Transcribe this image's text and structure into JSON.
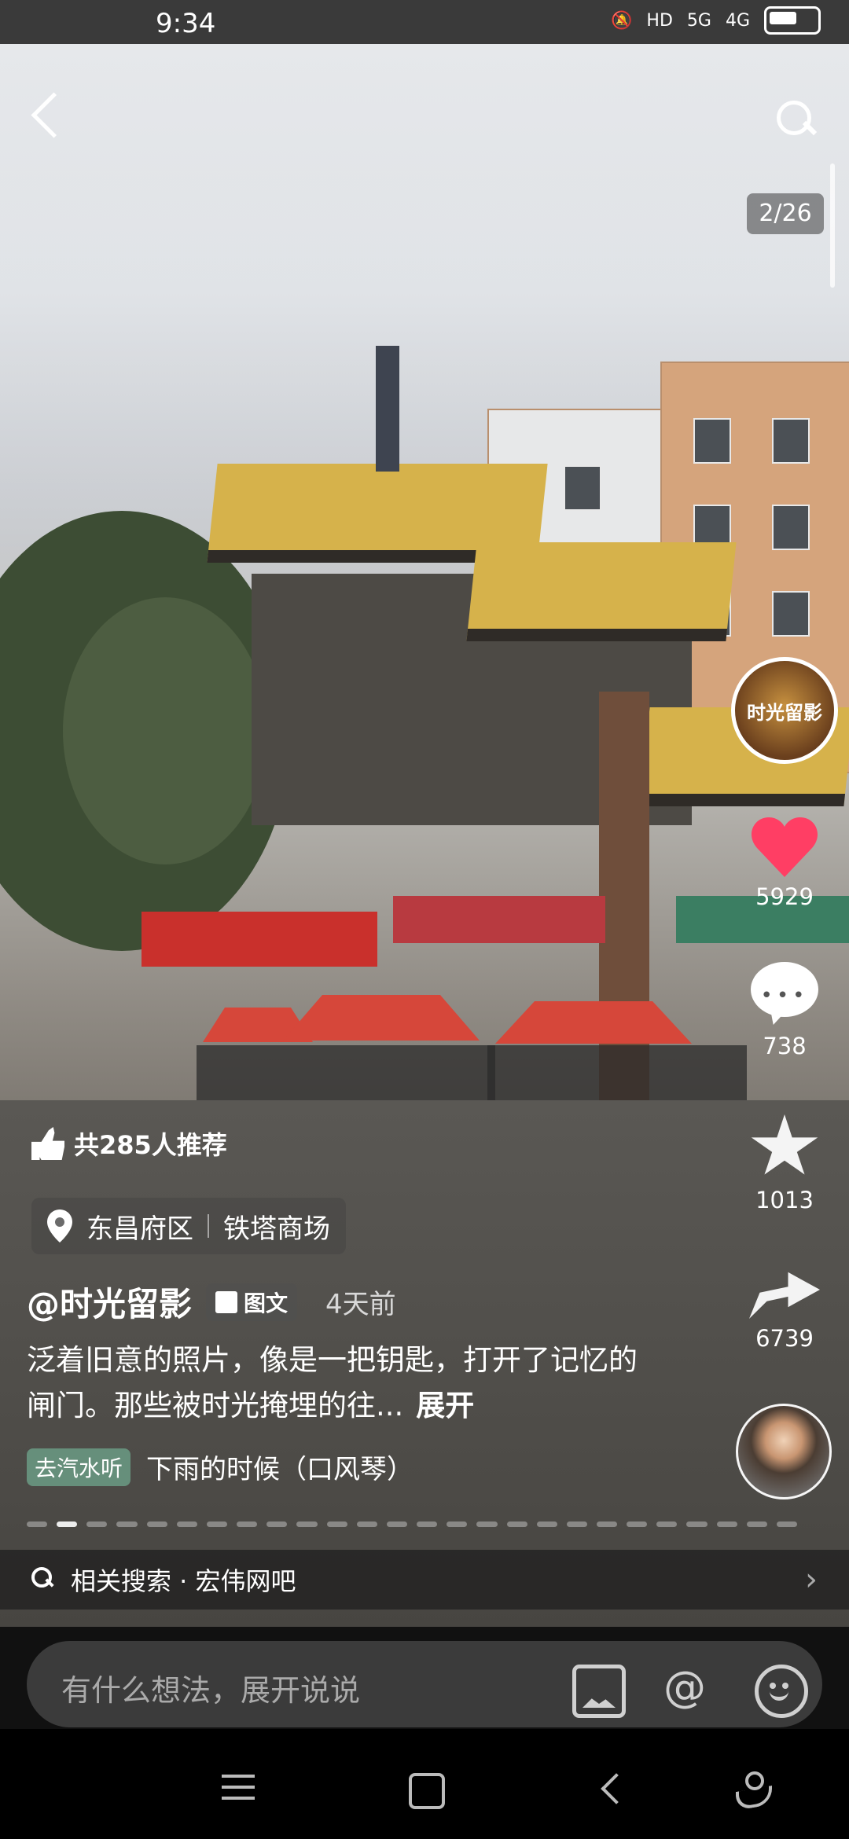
{
  "status_bar": {
    "time": "9:34",
    "network_icons": [
      "mute-icon",
      "HD",
      "5G",
      "4G",
      "battery-icon"
    ]
  },
  "header": {
    "image_counter": "2/26"
  },
  "author_avatar_text": "时光留影",
  "actions": {
    "likes": "5929",
    "comments": "738",
    "favorites": "1013",
    "shares": "6739"
  },
  "post": {
    "recommend_text": "共285人推荐",
    "location": {
      "district": "东昌府区",
      "place": "铁塔商场"
    },
    "author": "@时光留影",
    "type_tag": "图文",
    "time_ago": "4天前",
    "caption": "泛着旧意的照片，像是一把钥匙，打开了记忆的闸门。那些被时光掩埋的往...",
    "expand_label": "展开",
    "music_tag": "去汽水听",
    "music_title": "下雨的时候（口风琴）"
  },
  "related_search": {
    "label": "相关搜索 · 宏伟网吧"
  },
  "comment_box": {
    "placeholder": "有什么想法，展开说说"
  },
  "colors": {
    "like": "#ff3e64",
    "background": "#111111"
  }
}
